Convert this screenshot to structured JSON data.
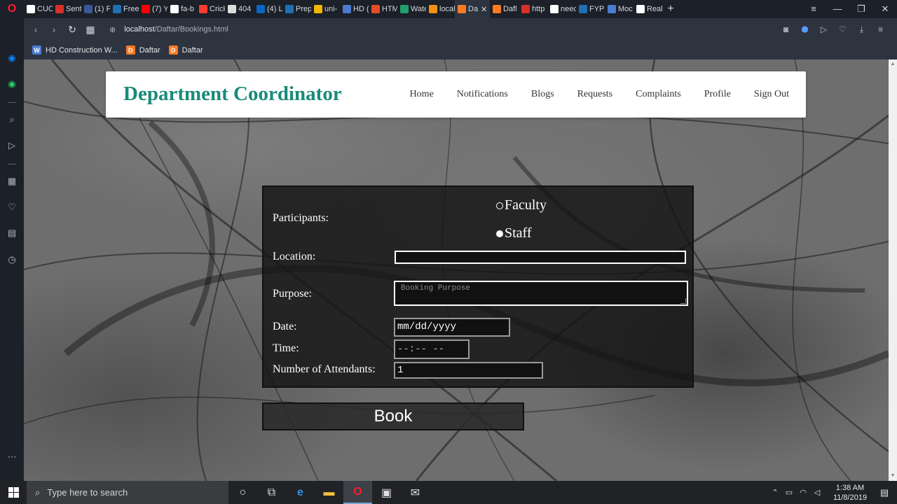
{
  "browser": {
    "tabs": [
      {
        "label": "CUC",
        "color": "#ffffff"
      },
      {
        "label": "Sent",
        "color": "#d93025"
      },
      {
        "label": "(1) F",
        "color": "#3b5998"
      },
      {
        "label": "Free",
        "color": "#1f6fb2"
      },
      {
        "label": "(7) Y",
        "color": "#ff0000"
      },
      {
        "label": "fa-b",
        "color": "#ffffff"
      },
      {
        "label": "Crick",
        "color": "#ff3b30"
      },
      {
        "label": "404",
        "color": "#dddddd"
      },
      {
        "label": "(4) L",
        "color": "#0a66c2"
      },
      {
        "label": "Prep",
        "color": "#1f6fb2"
      },
      {
        "label": "uni-",
        "color": "#f4b400"
      },
      {
        "label": "HD (",
        "color": "#4a7bd0"
      },
      {
        "label": "HTM",
        "color": "#e34c26"
      },
      {
        "label": "Wate",
        "color": "#22a06b"
      },
      {
        "label": "local",
        "color": "#f29111"
      },
      {
        "label": "Da",
        "color": "#fb7a24",
        "active": true
      },
      {
        "label": "Dafl",
        "color": "#fb7a24"
      },
      {
        "label": "http",
        "color": "#d93025"
      },
      {
        "label": "need",
        "color": "#ffffff"
      },
      {
        "label": "FYP",
        "color": "#1f6fb2"
      },
      {
        "label": "Moc",
        "color": "#4a7bd0"
      },
      {
        "label": "Real",
        "color": "#ffffff"
      }
    ],
    "url_host": "localhost",
    "url_path": "/Daftar/Bookings.html",
    "bookmarks": [
      {
        "label": "HD Construction W...",
        "icon": "W",
        "color": "#4a7bd0"
      },
      {
        "label": "Daftar",
        "icon": "D",
        "color": "#fb7a24"
      },
      {
        "label": "Daftar",
        "icon": "D",
        "color": "#fb7a24"
      }
    ]
  },
  "header": {
    "brand": "Department Coordinator",
    "nav": [
      "Home",
      "Notifications",
      "Blogs",
      "Requests",
      "Complaints",
      "Profile",
      "Sign Out"
    ]
  },
  "form": {
    "participants_label": "Participants:",
    "participant_options": [
      {
        "label": "Faculty",
        "selected": false
      },
      {
        "label": "Staff",
        "selected": true
      }
    ],
    "location_label": "Location:",
    "location_value": "",
    "purpose_label": "Purpose:",
    "purpose_placeholder": "Booking Purpose",
    "date_label": "Date:",
    "date_value": "mm/dd/yyyy",
    "time_label": "Time:",
    "time_value": "--:-- --",
    "attendants_label": "Number of Attendants:",
    "attendants_value": "1",
    "book_label": "Book"
  },
  "taskbar": {
    "search_placeholder": "Type here to search",
    "time": "1:38 AM",
    "date": "11/8/2019"
  }
}
